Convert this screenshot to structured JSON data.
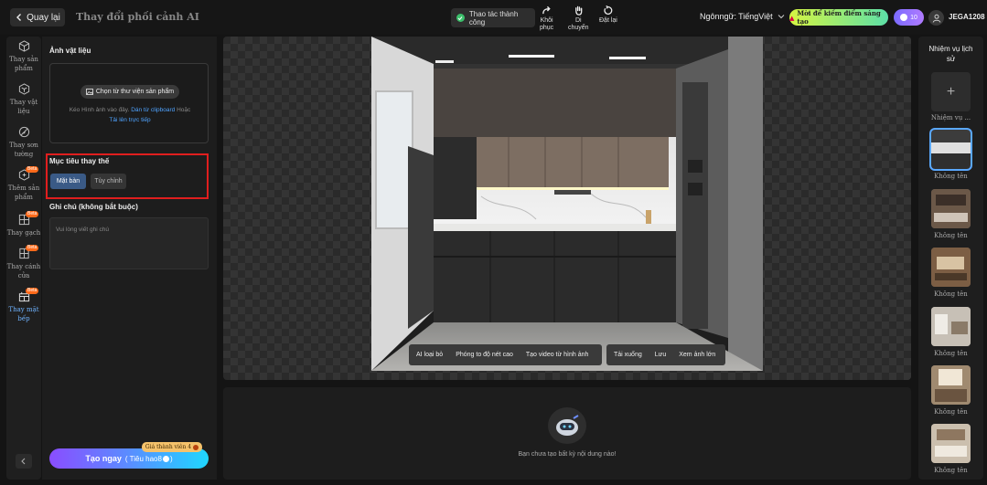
{
  "header": {
    "back_label": "Quay lại",
    "page_title": "Thay đổi phối cảnh AI",
    "toast_text": "Thao tác thành công",
    "tools": [
      {
        "label_1": "Khôi",
        "label_2": "phục",
        "icon": "redo-icon"
      },
      {
        "label_1": "Di",
        "label_2": "chuyển",
        "icon": "hand-icon"
      },
      {
        "label_1": "Đặt lại",
        "label_2": "",
        "icon": "reset-icon"
      }
    ],
    "language_label": "Ngônngữ:",
    "language_value": "TiếngViệt",
    "earn_label": "Mời để kiếm điểm sáng tạo",
    "credits": "10",
    "username": "JEGA1208"
  },
  "sidebar": {
    "items": [
      {
        "label_1": "Thay sản",
        "label_2": "phẩm",
        "icon": "cube-icon",
        "beta": ""
      },
      {
        "label_1": "Thay vật",
        "label_2": "liệu",
        "icon": "material-icon",
        "beta": ""
      },
      {
        "label_1": "Thay sơn",
        "label_2": "tường",
        "icon": "paint-icon",
        "beta": ""
      },
      {
        "label_1": "Thêm sản",
        "label_2": "phẩm",
        "icon": "add-product-icon",
        "beta": "Beta"
      },
      {
        "label_1": "Thay gạch",
        "label_2": "",
        "icon": "tile-icon",
        "beta": "Beta"
      },
      {
        "label_1": "Thay cánh",
        "label_2": "cửa",
        "icon": "door-icon",
        "beta": "Beta"
      },
      {
        "label_1": "Thay mặt",
        "label_2": "bếp",
        "icon": "kitchen-top-icon",
        "beta": "Beta"
      }
    ]
  },
  "panel": {
    "material_title": "Ảnh vật liệu",
    "pick_library": "Chọn từ thư viện sản phẩm",
    "upload_hint_1": "Kéo Hình ảnh vào đây.",
    "upload_hint_link1": "Dán từ clipboard",
    "upload_hint_or": "Hoặc",
    "upload_hint_link2": "Tải lên trực tiếp",
    "target_title": "Mục tiêu thay thế",
    "seg_active": "Mặt bàn",
    "seg_inactive": "Tùy chỉnh",
    "note_title": "Ghi chú (không bắt buộc)",
    "note_placeholder": "Vui lòng viết ghi chú",
    "member_tag": "Giá thành viên 4",
    "create_label": "Tạo ngay",
    "create_sub": "( Tiêu hao8",
    "create_sub_end": ")"
  },
  "image_toolbar": {
    "group1": [
      "AI loại bỏ",
      "Phóng to độ nét cao",
      "Tạo video từ hình ảnh"
    ],
    "group2": [
      "Tải xuống",
      "Lưu",
      "Xem ảnh lớn"
    ]
  },
  "result": {
    "empty_text": "Bạn chưa tạo bất kỳ nội dung nào!"
  },
  "history": {
    "title_1": "Nhiệm vụ lịch",
    "title_2": "sử",
    "add_label": "Nhiệm vụ ...",
    "items": [
      "Không tên",
      "Không tên",
      "Không tên",
      "Không tên",
      "Không tên",
      "Không tên"
    ]
  }
}
